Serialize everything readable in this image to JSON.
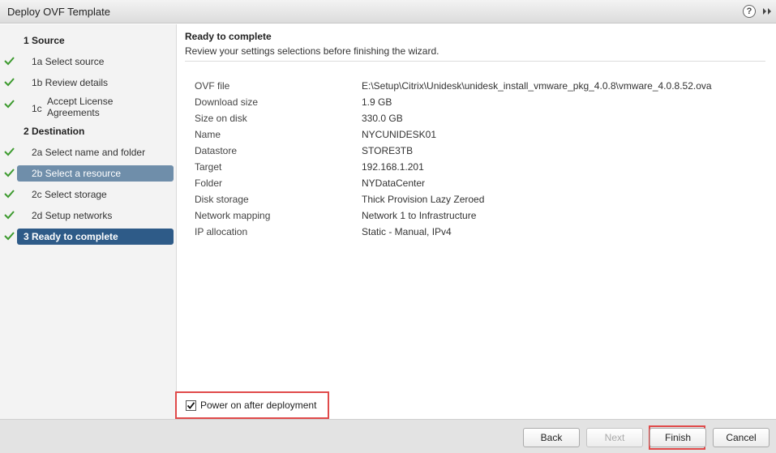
{
  "window": {
    "title": "Deploy OVF Template"
  },
  "sidebar": {
    "items": [
      {
        "label": "1  Source",
        "kind": "section",
        "checked": false
      },
      {
        "label": "1a  Select source",
        "kind": "step",
        "checked": true
      },
      {
        "label": "1b  Review details",
        "kind": "step",
        "checked": true
      },
      {
        "num": "1c",
        "label": "Accept License Agreements",
        "kind": "step",
        "checked": true
      },
      {
        "label": "2  Destination",
        "kind": "section",
        "checked": false
      },
      {
        "label": "2a  Select name and folder",
        "kind": "step",
        "checked": true
      },
      {
        "label": "2b  Select a resource",
        "kind": "step",
        "checked": true,
        "state": "selected"
      },
      {
        "label": "2c  Select storage",
        "kind": "step",
        "checked": true
      },
      {
        "label": "2d  Setup networks",
        "kind": "step",
        "checked": true
      },
      {
        "label": "3  Ready to complete",
        "kind": "section",
        "checked": true,
        "state": "current"
      }
    ]
  },
  "main": {
    "title": "Ready to complete",
    "description": "Review your settings selections before finishing the wizard.",
    "rows": [
      {
        "key": "OVF file",
        "value": "E:\\Setup\\Citrix\\Unidesk\\unidesk_install_vmware_pkg_4.0.8\\vmware_4.0.8.52.ova"
      },
      {
        "key": "Download size",
        "value": "1.9 GB"
      },
      {
        "key": "Size on disk",
        "value": "330.0 GB"
      },
      {
        "key": "Name",
        "value": "NYCUNIDESK01"
      },
      {
        "key": "Datastore",
        "value": "STORE3TB"
      },
      {
        "key": "Target",
        "value": "192.168.1.201"
      },
      {
        "key": "Folder",
        "value": "NYDataCenter"
      },
      {
        "key": "Disk storage",
        "value": "Thick Provision Lazy Zeroed"
      },
      {
        "key": "Network mapping",
        "value": "Network 1 to Infrastructure"
      },
      {
        "key": "IP allocation",
        "value": "Static - Manual, IPv4"
      }
    ]
  },
  "options": {
    "power_on_label": "Power on after deployment",
    "power_on_checked": true
  },
  "footer": {
    "back_label": "Back",
    "next_label": "Next",
    "finish_label": "Finish",
    "cancel_label": "Cancel"
  },
  "colors": {
    "selected_bg": "#6f8eaa",
    "current_bg": "#2e5b88",
    "check_green": "#3c9a2e",
    "highlight_red": "#e04a4a"
  },
  "icons": {
    "help": "?",
    "expand": "double-chevron-right-icon",
    "check": "checkmark-icon"
  }
}
